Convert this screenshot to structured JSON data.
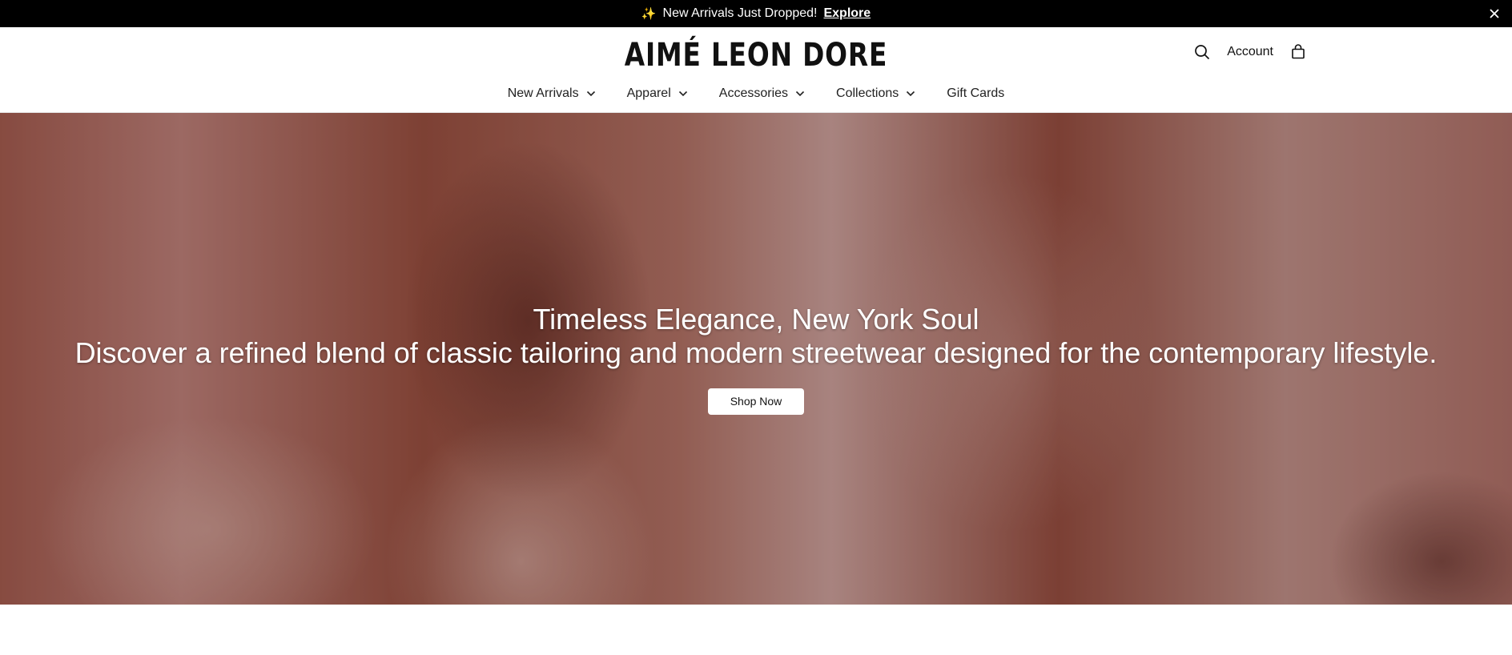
{
  "announcement": {
    "sparkle_icon": "sparkles-icon",
    "message": "New Arrivals Just Dropped!",
    "link_label": "Explore"
  },
  "header": {
    "logo": "AIMÉ LEON DORE",
    "account_label": "Account",
    "nav": [
      {
        "label": "New Arrivals",
        "has_dropdown": true
      },
      {
        "label": "Apparel",
        "has_dropdown": true
      },
      {
        "label": "Accessories",
        "has_dropdown": true
      },
      {
        "label": "Collections",
        "has_dropdown": true
      },
      {
        "label": "Gift Cards",
        "has_dropdown": false
      }
    ]
  },
  "hero": {
    "title": "Timeless Elegance, New York Soul",
    "subtitle": "Discover a refined blend of classic tailoring and modern streetwear designed for the contemporary lifestyle.",
    "cta_label": "Shop Now"
  },
  "colors": {
    "announcement_bg": "#000000",
    "hero_tint": "#8e4d3e",
    "button_bg": "#ffffff"
  }
}
